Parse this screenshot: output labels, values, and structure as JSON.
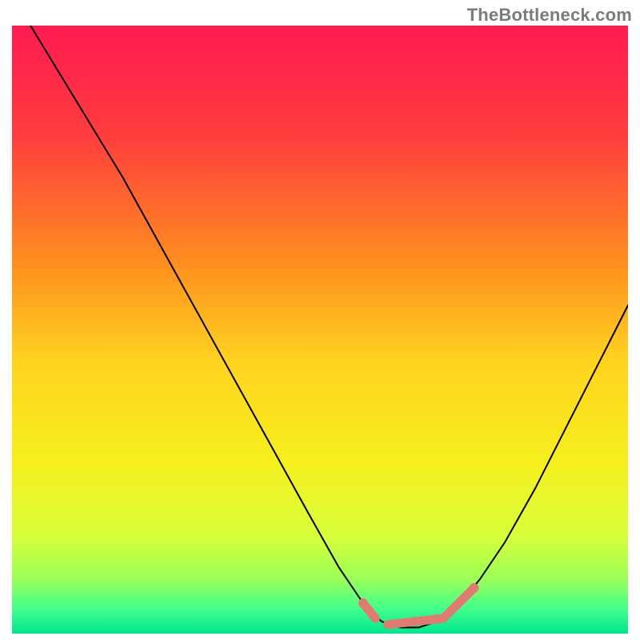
{
  "attribution": "TheBottleneck.com",
  "chart_data": {
    "type": "line",
    "title": "",
    "xlabel": "",
    "ylabel": "",
    "xlim": [
      0,
      100
    ],
    "ylim": [
      0,
      100
    ],
    "gradient_stops": [
      {
        "offset": 0,
        "color": "#ff1a52"
      },
      {
        "offset": 18,
        "color": "#ff3d3d"
      },
      {
        "offset": 38,
        "color": "#ff8a1f"
      },
      {
        "offset": 55,
        "color": "#ffd21f"
      },
      {
        "offset": 72,
        "color": "#f6f01e"
      },
      {
        "offset": 84,
        "color": "#d7ff3a"
      },
      {
        "offset": 91,
        "color": "#9cff57"
      },
      {
        "offset": 96,
        "color": "#40ff8c"
      },
      {
        "offset": 100,
        "color": "#00e68f"
      }
    ],
    "curve": [
      {
        "x": 3,
        "y": 100
      },
      {
        "x": 6,
        "y": 95
      },
      {
        "x": 12,
        "y": 85
      },
      {
        "x": 18,
        "y": 75
      },
      {
        "x": 24,
        "y": 64
      },
      {
        "x": 30,
        "y": 53
      },
      {
        "x": 36,
        "y": 42
      },
      {
        "x": 42,
        "y": 31
      },
      {
        "x": 48,
        "y": 20
      },
      {
        "x": 53,
        "y": 11
      },
      {
        "x": 57,
        "y": 5
      },
      {
        "x": 60,
        "y": 2
      },
      {
        "x": 63,
        "y": 1
      },
      {
        "x": 66,
        "y": 1
      },
      {
        "x": 69,
        "y": 2
      },
      {
        "x": 72,
        "y": 4
      },
      {
        "x": 76,
        "y": 9
      },
      {
        "x": 80,
        "y": 15
      },
      {
        "x": 85,
        "y": 24
      },
      {
        "x": 90,
        "y": 34
      },
      {
        "x": 95,
        "y": 44
      },
      {
        "x": 100,
        "y": 54
      }
    ],
    "highlight_segments": [
      {
        "x1": 57,
        "y1": 5,
        "x2": 59,
        "y2": 2.5,
        "dot_start": true
      },
      {
        "x1": 61,
        "y1": 1.5,
        "x2": 70,
        "y2": 2.5
      },
      {
        "x1": 70,
        "y1": 2.5,
        "x2": 75,
        "y2": 7.5,
        "dot_end": true
      }
    ],
    "curve_color": "#000000",
    "curve_width": 2,
    "highlight_color": "#e07b72",
    "highlight_width": 11,
    "background": "#ffffff"
  }
}
